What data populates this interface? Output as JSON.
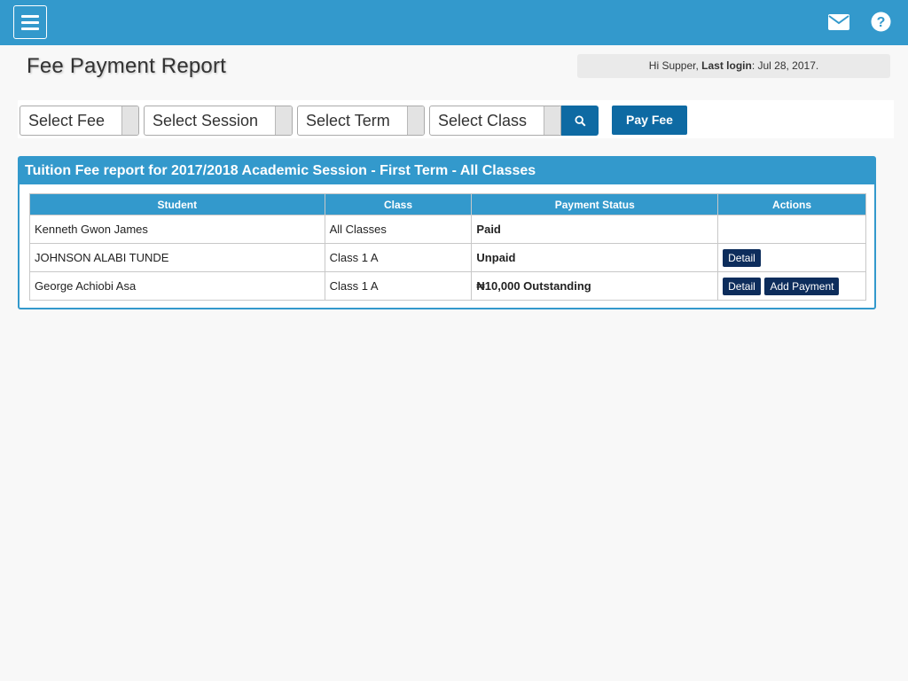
{
  "topbar": {
    "menu_icon": "hamburger-menu-icon",
    "mail_icon": "envelope-icon",
    "help_icon": "question-circle-icon",
    "color": "#3399cc"
  },
  "page": {
    "title": "Fee Payment Report",
    "greeting": "Hi Supper, ",
    "last_login_label": "Last login",
    "last_login_value": ": Jul 28, 2017."
  },
  "filters": {
    "fee": "Select Fee",
    "session": "Select Session",
    "term": "Select Term",
    "class": "Select Class",
    "search_icon": "search-icon",
    "pay_fee_label": "Pay Fee"
  },
  "report": {
    "heading": "Tuition Fee report for 2017/2018 Academic Session - First Term - All Classes",
    "columns": [
      "Student",
      "Class",
      "Payment Status",
      "Actions"
    ],
    "rows": [
      {
        "student": "Kenneth Gwon James",
        "class": "All Classes",
        "status": "Paid",
        "status_type": "paid",
        "actions": []
      },
      {
        "student": "JOHNSON ALABI TUNDE",
        "class": "Class 1 A",
        "status": "Unpaid",
        "status_type": "unpaid",
        "actions": [
          "Detail"
        ]
      },
      {
        "student": "George Achiobi Asa",
        "class": "Class 1 A",
        "status": "₦10,000 Outstanding",
        "status_type": "outstanding",
        "actions": [
          "Detail",
          "Add Payment"
        ]
      }
    ]
  },
  "colors": {
    "accent": "#3399cc",
    "button": "#0e6aa3",
    "action_button": "#0d2d5c",
    "paid": "#228822",
    "unpaid": "#e02222",
    "outstanding": "#d9731a"
  }
}
